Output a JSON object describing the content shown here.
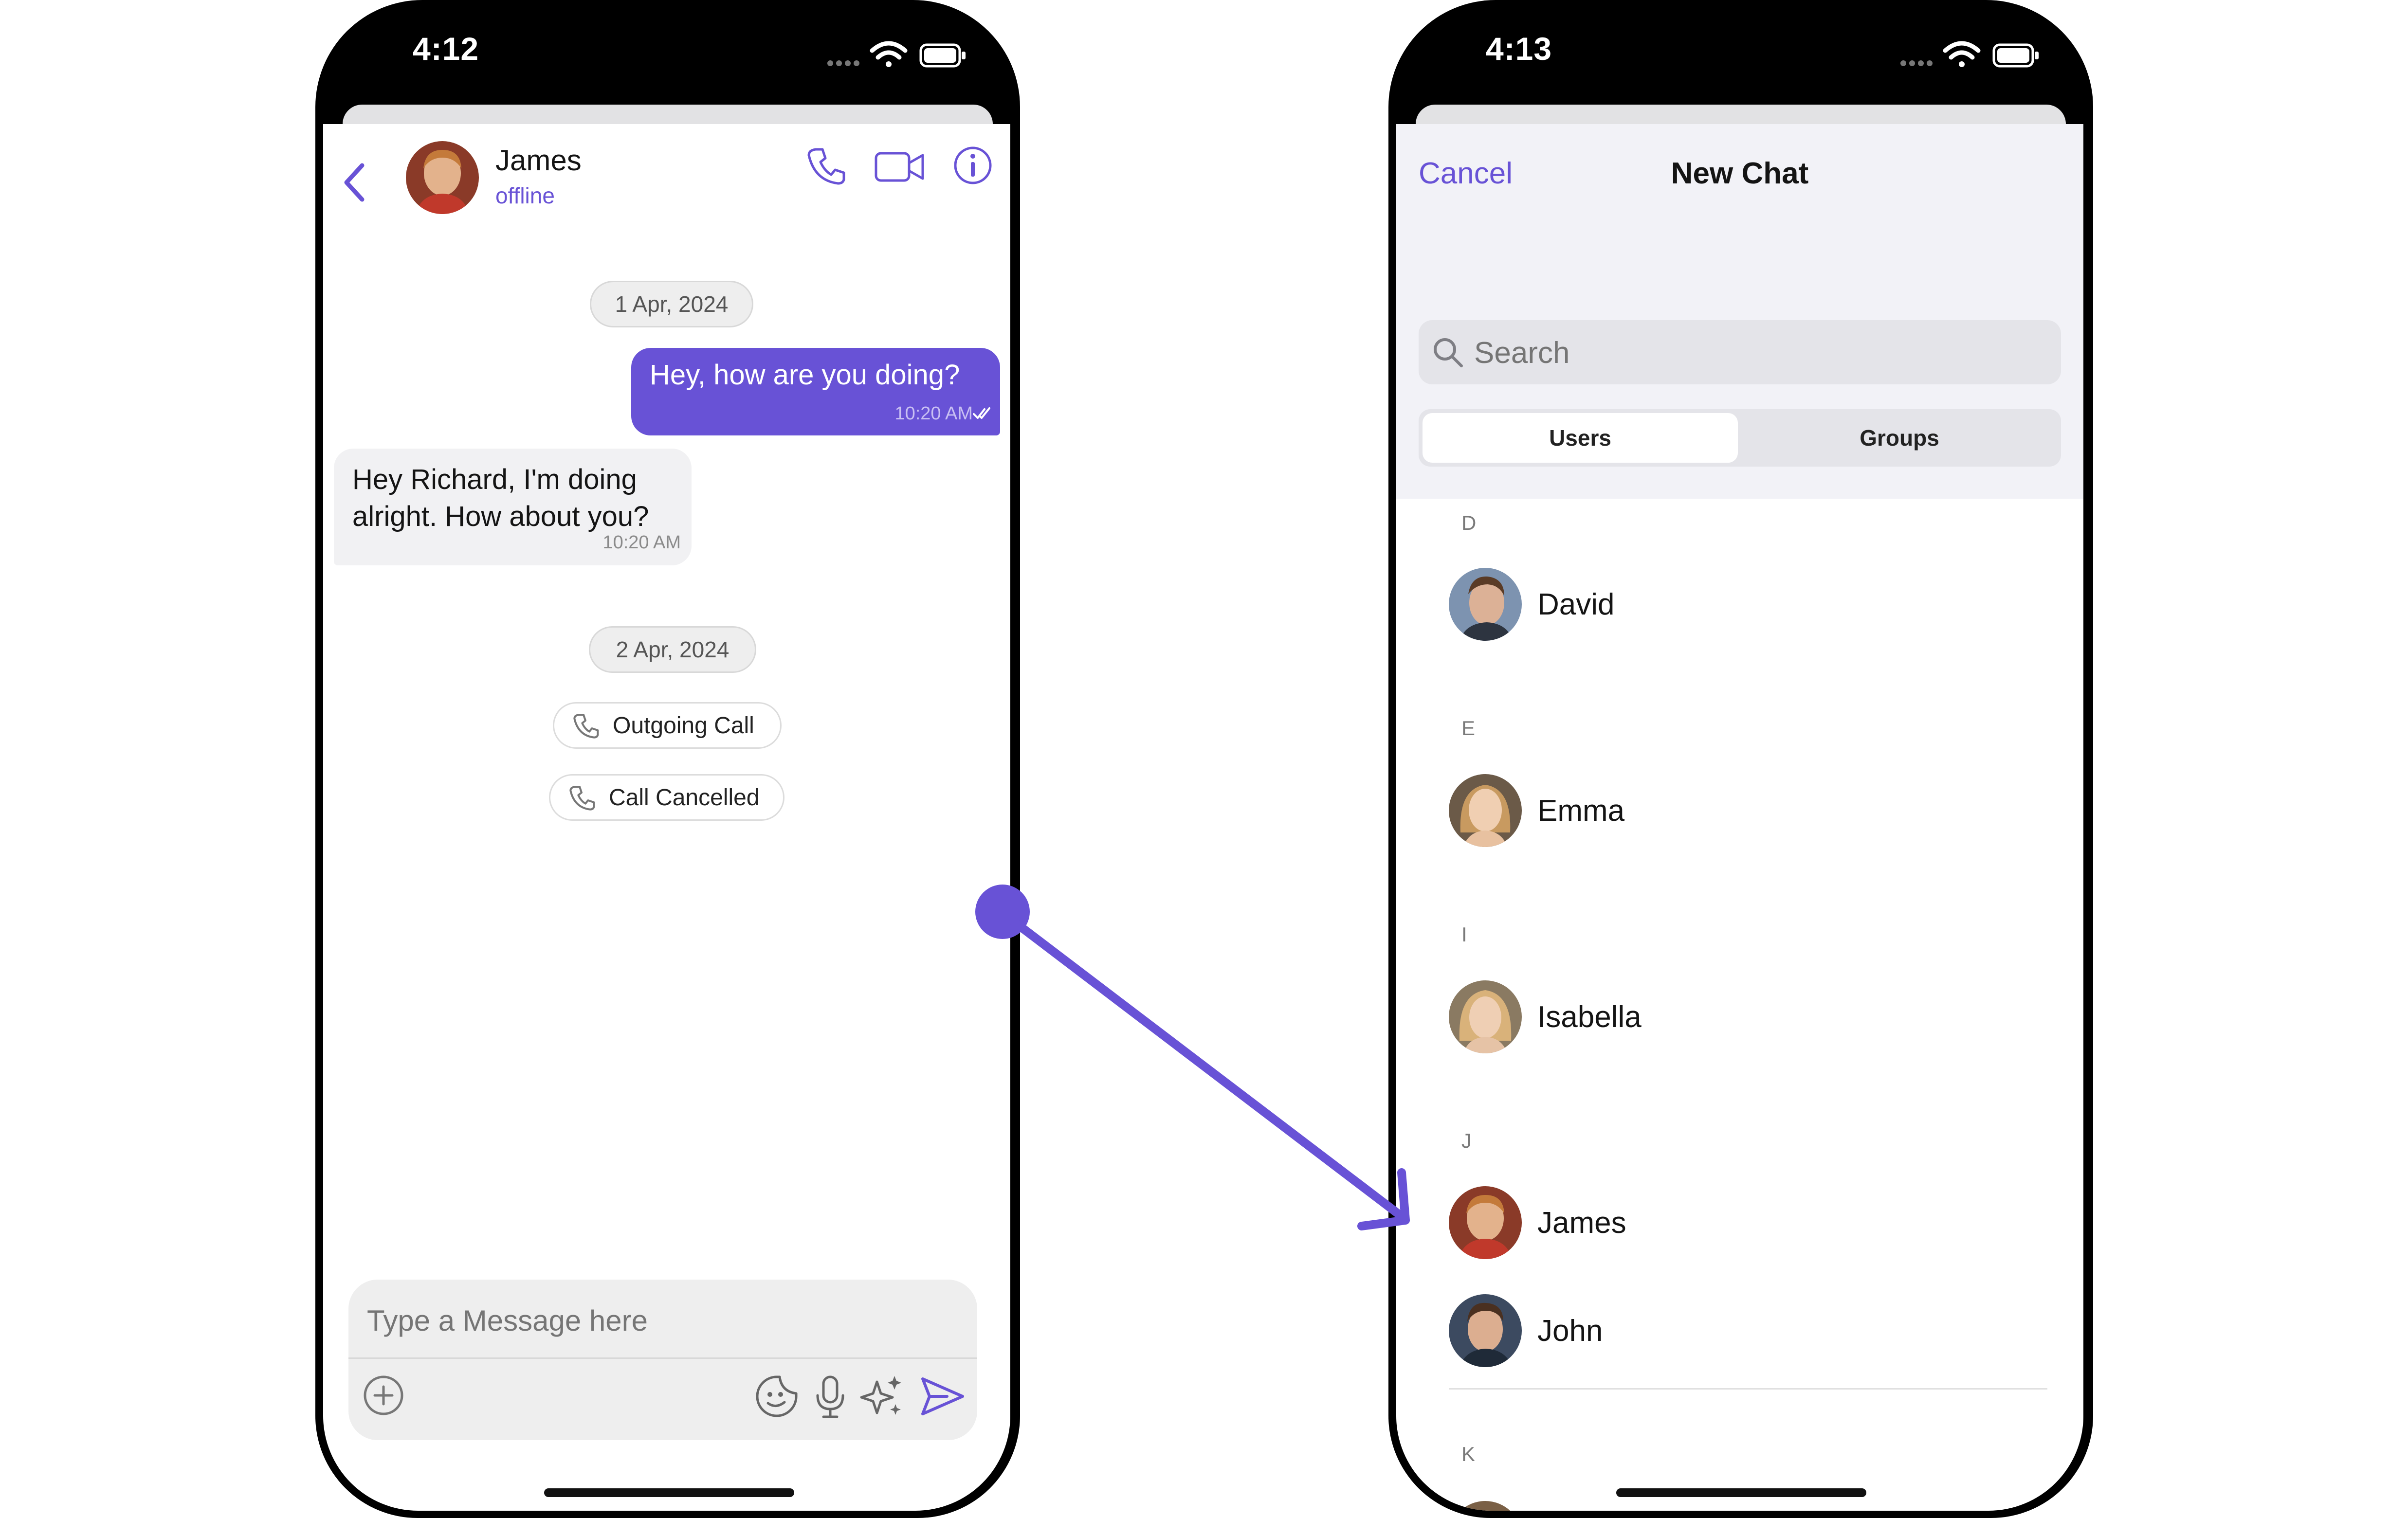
{
  "left_phone": {
    "status": {
      "time": "4:12"
    },
    "header": {
      "name": "James",
      "status": "offline"
    },
    "messages": [
      {
        "type": "date",
        "text": "1 Apr, 2024"
      },
      {
        "type": "outgoing",
        "text": "Hey, how are you doing?",
        "time": "10:20 AM"
      },
      {
        "type": "incoming",
        "text": "Hey Richard, I'm doing alright. How about you?",
        "time": "10:20 AM"
      },
      {
        "type": "date",
        "text": "2 Apr, 2024"
      },
      {
        "type": "call",
        "text": "Outgoing Call"
      },
      {
        "type": "call",
        "text": "Call Cancelled"
      }
    ],
    "composer": {
      "placeholder": "Type a Message here"
    }
  },
  "right_phone": {
    "status": {
      "time": "4:13"
    },
    "nav": {
      "cancel": "Cancel",
      "title": "New Chat"
    },
    "search": {
      "placeholder": "Search"
    },
    "tabs": [
      {
        "label": "Users",
        "active": true
      },
      {
        "label": "Groups",
        "active": false
      }
    ],
    "sections": [
      {
        "letter": "D",
        "users": [
          "David"
        ]
      },
      {
        "letter": "E",
        "users": [
          "Emma"
        ]
      },
      {
        "letter": "I",
        "users": [
          "Isabella"
        ]
      },
      {
        "letter": "J",
        "users": [
          "James",
          "John"
        ]
      },
      {
        "letter": "K",
        "users": []
      }
    ]
  },
  "colors": {
    "accent": "#6852d6",
    "bubble_in": "#f1f1f3",
    "nav_bg": "#f2f2f7"
  },
  "icons": [
    "chevron-left-icon",
    "phone-icon",
    "video-icon",
    "info-icon",
    "add-icon",
    "sticker-icon",
    "mic-icon",
    "ai-sparkle-icon",
    "send-icon",
    "search-icon",
    "wifi-icon",
    "battery-icon",
    "signal-icon"
  ]
}
